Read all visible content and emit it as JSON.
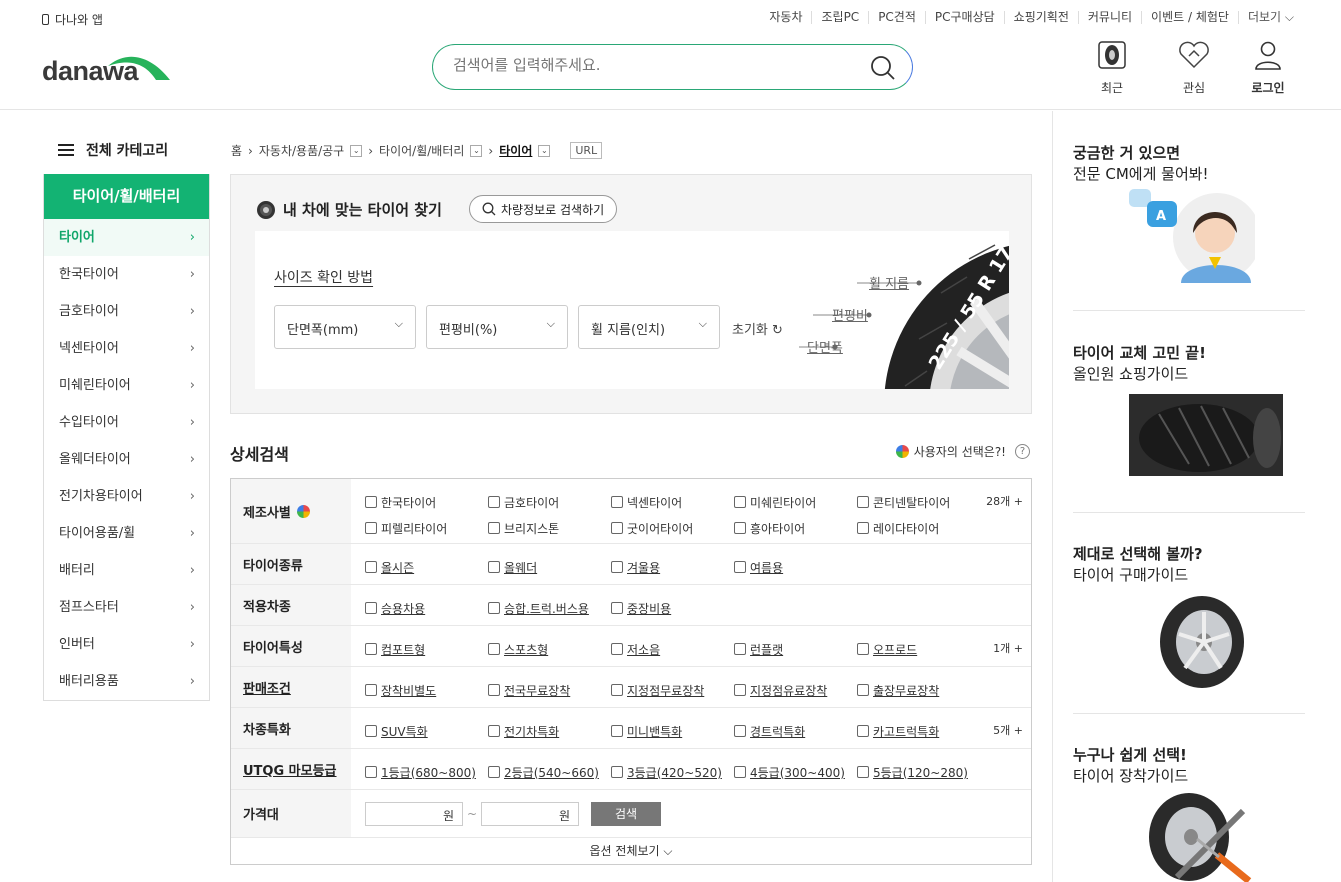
{
  "header": {
    "app_link": "다나와 앱",
    "top_menu": [
      "자동차",
      "조립PC",
      "PC견적",
      "PC구매상담",
      "쇼핑기획전",
      "커뮤니티",
      "이벤트 / 체험단",
      "더보기 ⌵"
    ],
    "logo": "danawa",
    "search_placeholder": "검색어를 입력해주세요.",
    "utils": {
      "recent": "최근",
      "wish": "관심",
      "login": "로그인"
    }
  },
  "sidebar": {
    "header": "전체 카테고리",
    "title": "타이어/휠/배터리",
    "items": [
      "타이어",
      "한국타이어",
      "금호타이어",
      "넥센타이어",
      "미쉐린타이어",
      "수입타이어",
      "올웨더타이어",
      "전기차용타이어",
      "타이어용품/휠",
      "배터리",
      "점프스타터",
      "인버터",
      "배터리용품"
    ],
    "chevron": "›"
  },
  "breadcrumb": {
    "home": "홈",
    "c1": "자동차/용품/공구",
    "c2": "타이어/휠/배터리",
    "c3": "타이어",
    "url": "URL"
  },
  "finder": {
    "title": "내 차에 맞는 타이어 찾기",
    "vehicle_btn": "차량정보로 검색하기",
    "size_help": "사이즈 확인 방법",
    "selects": [
      "단면폭(mm)",
      "편평비(%)",
      "휠 지름(인치)"
    ],
    "reset": "초기화",
    "labels": {
      "wheel": "휠 지름",
      "ratio": "편평비",
      "width": "단면폭",
      "size_code": "225 / 55 R 17"
    }
  },
  "detail": {
    "title": "상세검색",
    "user_choice": "사용자의 선택은?!",
    "help": "?",
    "rows": [
      {
        "label": "제조사별",
        "options": [
          "한국타이어",
          "금호타이어",
          "넥센타이어",
          "미쉐린타이어",
          "콘티넨탈타이어",
          "피렐리타이어",
          "브리지스톤",
          "굿이어타이어",
          "흥아타이어",
          "레이다타이어"
        ],
        "more": "28개 +"
      },
      {
        "label": "타이어종류",
        "options": [
          "올시즌",
          "올웨더",
          "겨울용",
          "여름용"
        ],
        "more": ""
      },
      {
        "label": "적용차종",
        "options": [
          "승용차용",
          "승합.트럭.버스용",
          "중장비용"
        ],
        "more": ""
      },
      {
        "label": "타이어특성",
        "options": [
          "컴포트형",
          "스포츠형",
          "저소음",
          "런플랫",
          "오프로드"
        ],
        "more": "1개 +"
      },
      {
        "label": "판매조건",
        "options": [
          "장착비별도",
          "전국무료장착",
          "지정점무료장착",
          "지정점유료장착",
          "출장무료장착"
        ],
        "more": ""
      },
      {
        "label": "차종특화",
        "options": [
          "SUV특화",
          "전기차특화",
          "미니밴특화",
          "경트럭특화",
          "카고트럭특화"
        ],
        "more": "5개 +"
      },
      {
        "label": "UTQG 마모등급",
        "options": [
          "1등급(680~800)",
          "2등급(540~660)",
          "3등급(420~520)",
          "4등급(300~400)",
          "5등급(120~280)"
        ],
        "more": ""
      }
    ],
    "price": {
      "label": "가격대",
      "unit": "원",
      "tilde": "~",
      "button": "검색"
    },
    "all_options": "옵션 전체보기 ⌵"
  },
  "promos": [
    {
      "t1": "궁금한 거 있으면",
      "t2": "전문 CM에게 물어봐!",
      "bubble": "A"
    },
    {
      "t1": "타이어 교체 고민 끝!",
      "t2": "올인원 쇼핑가이드"
    },
    {
      "t1": "제대로 선택해 볼까?",
      "t2": "타이어 구매가이드"
    },
    {
      "t1": "누구나 쉽게 선택!",
      "t2": "타이어 장착가이드"
    }
  ]
}
